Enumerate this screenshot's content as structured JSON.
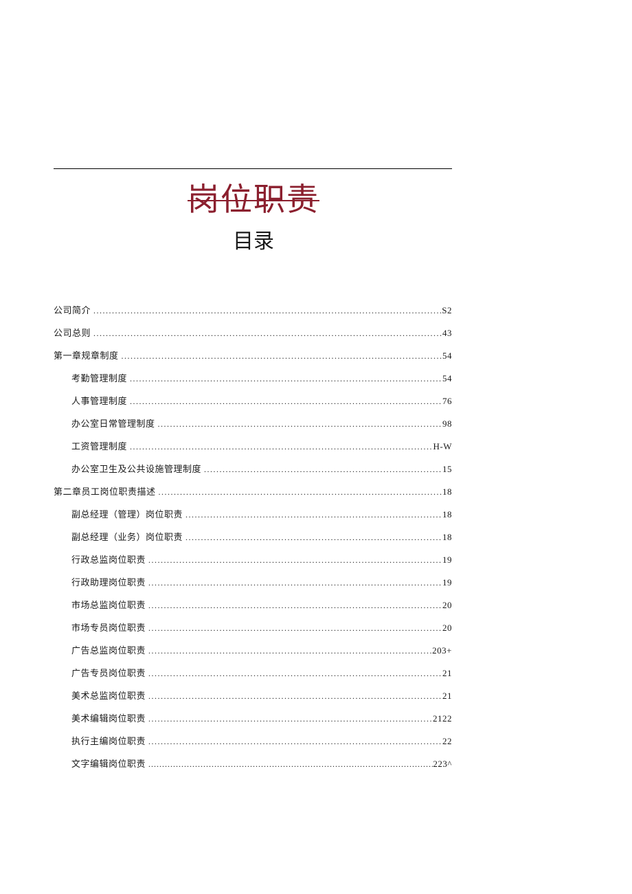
{
  "title_main": "岗位职责",
  "title_sub": "目录",
  "toc": [
    {
      "level": 1,
      "label": "公司简介",
      "page": "S2"
    },
    {
      "level": 1,
      "label": "公司总则",
      "page": "43"
    },
    {
      "level": 1,
      "label": "第一章规章制度",
      "page": "54"
    },
    {
      "level": 2,
      "label": "考勤管理制度",
      "page": "54"
    },
    {
      "level": 2,
      "label": "人事管理制度",
      "page": "76"
    },
    {
      "level": 2,
      "label": "办公室日常管理制度",
      "page": "98"
    },
    {
      "level": 2,
      "label": "工资管理制度",
      "page": "H-W"
    },
    {
      "level": 2,
      "label": "办公室卫生及公共设施管理制度",
      "page": "15"
    },
    {
      "level": 1,
      "label": "第二章员工岗位职责描述",
      "page": "18"
    },
    {
      "level": 2,
      "label": "副总经理（管理）岗位职责",
      "page": "18"
    },
    {
      "level": 2,
      "label": "副总经理（业务）岗位职责",
      "page": "18"
    },
    {
      "level": 2,
      "label": "行政总监岗位职责",
      "page": "19"
    },
    {
      "level": 2,
      "label": "行政助理岗位职责",
      "page": "19"
    },
    {
      "level": 2,
      "label": "市场总监岗位职责",
      "page": "20"
    },
    {
      "level": 2,
      "label": "市场专员岗位职责",
      "page": "20"
    },
    {
      "level": 2,
      "label": "广告总监岗位职责",
      "page": "203+"
    },
    {
      "level": 2,
      "label": "广告专员岗位职责",
      "page": "21"
    },
    {
      "level": 2,
      "label": "美术总监岗位职责",
      "page": "21"
    },
    {
      "level": 2,
      "label": "美术编辑岗位职责",
      "page": "2122"
    },
    {
      "level": 2,
      "label": "执行主编岗位职责",
      "page": "22"
    },
    {
      "level": 2,
      "label": "文字编辑岗位职责",
      "page": "223^"
    }
  ]
}
